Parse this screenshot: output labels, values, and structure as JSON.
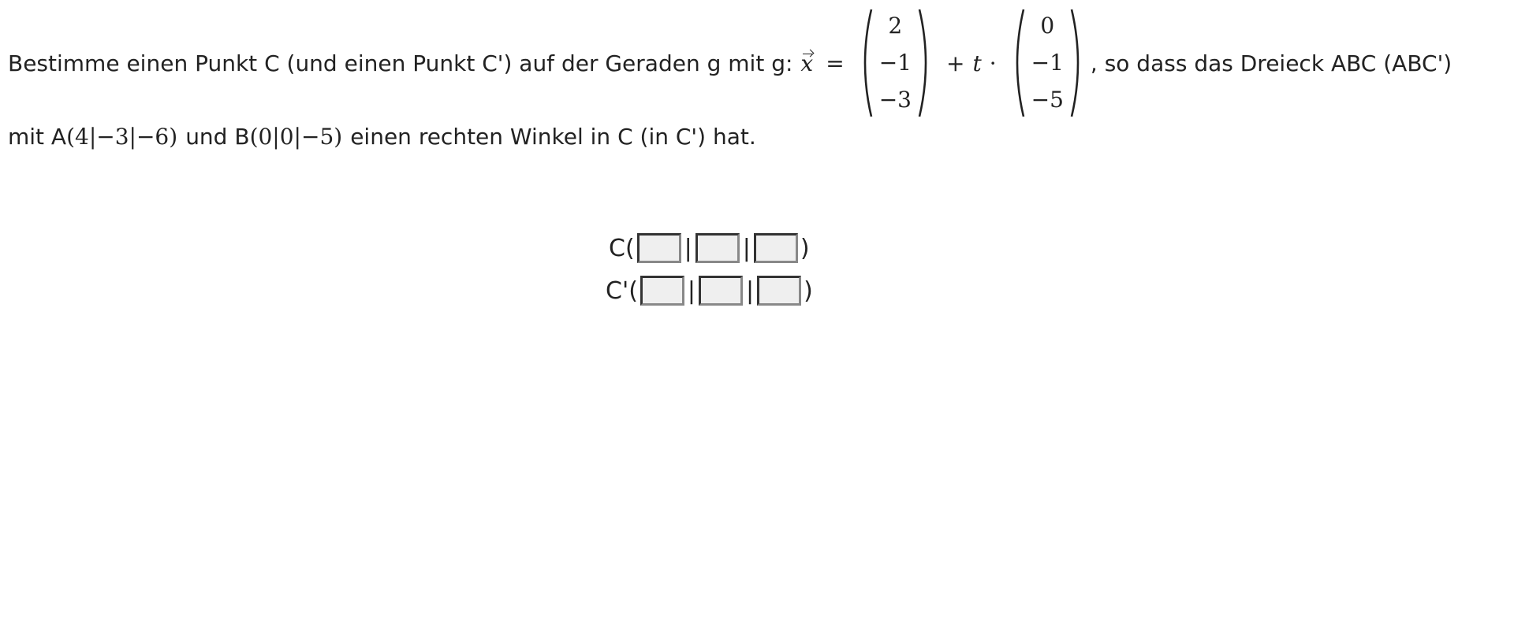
{
  "task": {
    "line1_text_before": "Bestimme einen Punkt C (und einen Punkt C') auf der Geraden g mit g:",
    "equals": "=",
    "support_vector": [
      "2",
      "−1",
      "−3"
    ],
    "plus": "+",
    "parameter": "t",
    "dot": "·",
    "direction_vector": [
      "0",
      "−1",
      "−5"
    ],
    "line1_text_after": ", so dass das Dreieck ABC (ABC')",
    "line2_prefix_A": "mit A",
    "point_A": "(4|−3|−6)",
    "line2_mid": "und B",
    "point_B": "(0|0|−5)",
    "line2_suffix": "einen rechten Winkel in C (in C') hat."
  },
  "answer": {
    "c_label": "C(",
    "c_prime_label": "C'(",
    "separator": "|",
    "close_paren": ")",
    "c_values": [
      "",
      "",
      ""
    ],
    "c_prime_values": [
      "",
      "",
      ""
    ]
  }
}
